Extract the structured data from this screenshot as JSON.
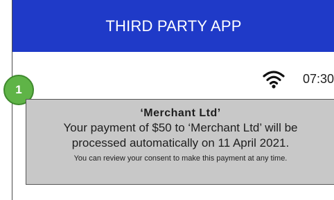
{
  "header": {
    "title": "THIRD PARTY APP",
    "background": "#1f3ac8"
  },
  "status_bar": {
    "icon": "wifi-icon",
    "time": "07:30"
  },
  "step_badge": {
    "number": "1",
    "color": "#5fb447"
  },
  "notification": {
    "title": "‘Merchant Ltd’",
    "body_line_1": "Your payment of $50 to ‘Merchant Ltd’ will be",
    "body_line_2": "processed automatically on 11 April 2021.",
    "footnote": "You can review your consent to make this payment at any time.",
    "background": "#c8c8c8"
  }
}
